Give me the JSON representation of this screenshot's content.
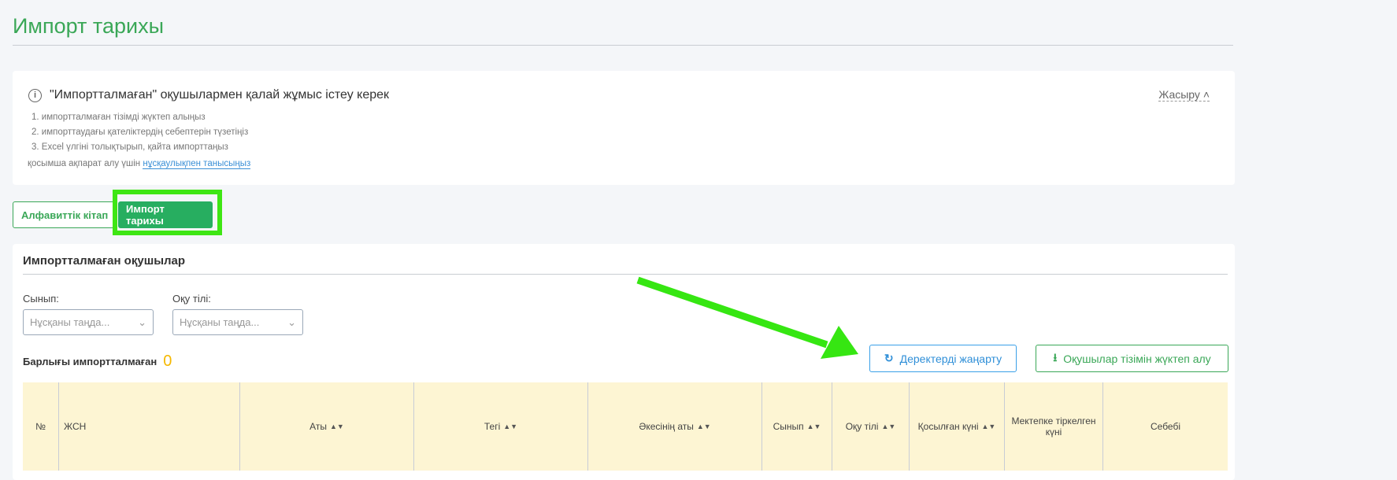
{
  "page": {
    "title": "Импорт тарихы"
  },
  "info": {
    "heading": "\"Импортталмаған\" оқушылармен қалай жұмыс істеу керек",
    "hide_label": "Жасыру",
    "steps": [
      "1. импортталмаған тізімді жүктеп алыңыз",
      "2. импорттаудағы қателіктердің себептерін түзетіңіз",
      "3. Excel үлгіні толықтырып, қайта импорттаңыз"
    ],
    "more_text": "қосымша ақпарат алу үшін",
    "more_link": "нұсқаулықпен танысыңыз"
  },
  "tabs": [
    {
      "label": "Алфавиттік кітап"
    },
    {
      "label": "Импорт тарихы"
    }
  ],
  "card": {
    "title": "Импортталмаған оқушылар",
    "filters": [
      {
        "label": "Сынып:",
        "placeholder": "Нұсқаны таңда..."
      },
      {
        "label": "Оқу тілі:",
        "placeholder": "Нұсқаны таңда..."
      }
    ],
    "total_label": "Барлығы импортталмаған",
    "total_value": "0",
    "refresh_label": "Деректерді жаңарту",
    "download_label": "Оқушылар тізімін жүктеп алу",
    "columns": [
      "№",
      "ЖСН",
      "Аты",
      "Тегі",
      "Әкесінің аты",
      "Сынып",
      "Оқу тілі",
      "Қосылған күні",
      "Мектепке тіркелген күні",
      "Себебі"
    ]
  },
  "colors": {
    "accent": "#3aa757",
    "highlight": "#3ee614"
  }
}
